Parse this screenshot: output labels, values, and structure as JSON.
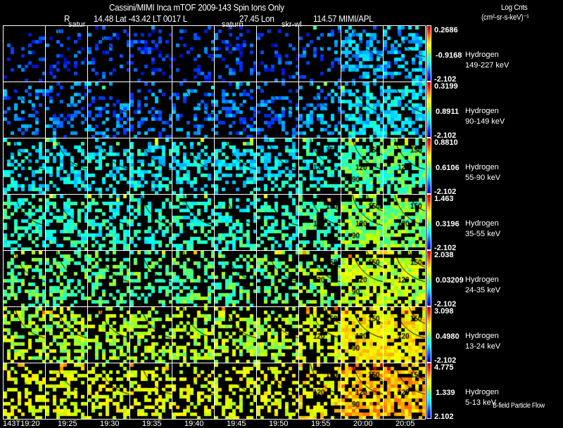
{
  "header": {
    "title": "Cassini/MIMI Inca mTOF  2009-143   Spin   Ions Only",
    "r_label": "R",
    "pos1": "14.48 Lat -43.42 LT 0017 L",
    "pos2": "27.45 Lon",
    "pos3": "114.57  MIMI/APL",
    "units_title": "Log Cnts",
    "units": "(cm²-sr-s-keV)⁻¹"
  },
  "overlay_labels": [
    "satur",
    "saturn",
    "skr-wl"
  ],
  "footer_note": "B-field Particle Flow",
  "chart_data": {
    "type": "heatmap",
    "time_labels": [
      "143T19:20",
      "19:25",
      "19:30",
      "19:35",
      "19:40",
      "19:45",
      "19:50",
      "19:55",
      "20:00",
      "20:05"
    ],
    "contour_labels": [
      "90",
      "120",
      "150"
    ],
    "rows": [
      {
        "species": "Hydrogen",
        "energy": "149-227 keV",
        "cmax": "0.2686",
        "cmid": "-0.9168",
        "cmin": "-2.102",
        "level": 0.12,
        "density": 0.22
      },
      {
        "species": "Hydrogen",
        "energy": "90-149 keV",
        "cmax": "0.3199",
        "cmid": "0.8911",
        "cmin": "-2.102",
        "level": 0.18,
        "density": 0.3
      },
      {
        "species": "Hydrogen",
        "energy": "55-90 keV",
        "cmax": "0.8810",
        "cmid": "0.6106",
        "cmin": "-2.102",
        "level": 0.32,
        "density": 0.42
      },
      {
        "species": "Hydrogen",
        "energy": "35-55 keV",
        "cmax": "1.463",
        "cmid": "0.3196",
        "cmin": "-2.102",
        "level": 0.38,
        "density": 0.48
      },
      {
        "species": "Hydrogen",
        "energy": "24-35 keV",
        "cmax": "2.038",
        "cmid": "0.03209",
        "cmin": "-2.102",
        "level": 0.45,
        "density": 0.45
      },
      {
        "species": "Hydrogen",
        "energy": "13-24 keV",
        "cmax": "3.098",
        "cmid": "0.4980",
        "cmin": "-2.102",
        "level": 0.55,
        "density": 0.5
      },
      {
        "species": "Hydrogen",
        "energy": "5-13 keV",
        "cmax": "4.775",
        "cmid": "1.339",
        "cmin": "2.102",
        "level": 0.62,
        "density": 0.45
      }
    ]
  }
}
